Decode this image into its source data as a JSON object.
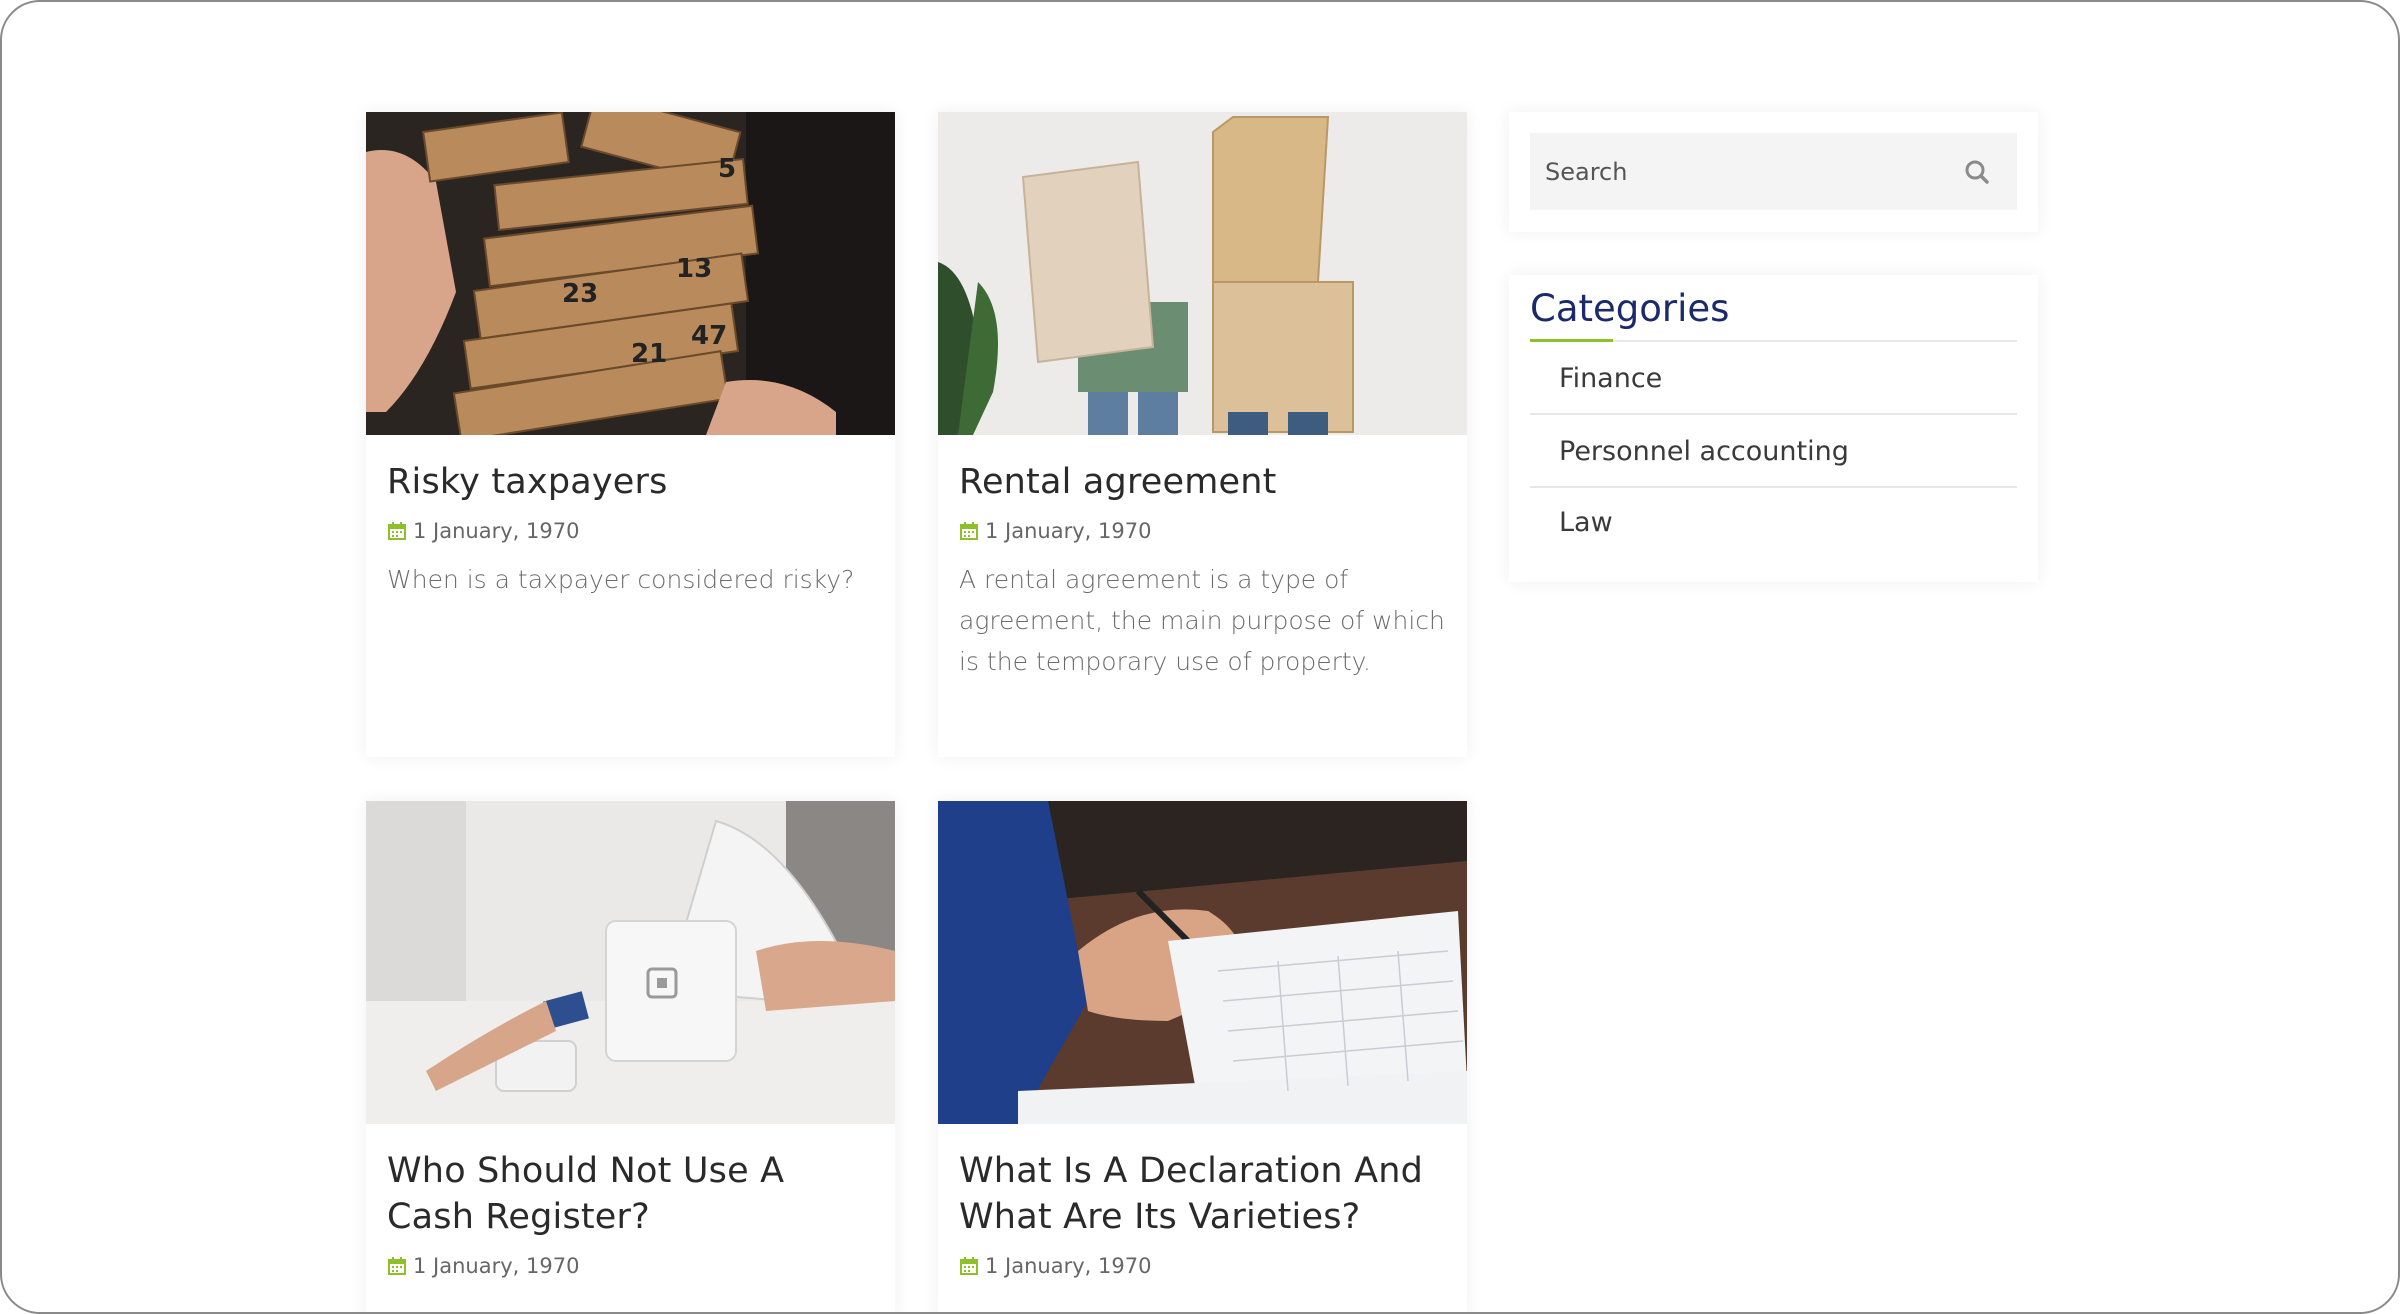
{
  "posts": [
    {
      "title": "Risky taxpayers",
      "date": "1 January, 1970",
      "excerpt": "When is a taxpayer considered risky?",
      "image_alt": "wooden block tower game"
    },
    {
      "title": "Rental agreement",
      "date": "1 January, 1970",
      "excerpt": "A rental agreement is a type of agreement, the main purpose of which is the temporary use of property.",
      "image_alt": "people carrying cardboard boxes"
    },
    {
      "title": "Who Should Not Use A Cash Register?",
      "date": "1 January, 1970",
      "excerpt": "",
      "image_alt": "card payment terminal"
    },
    {
      "title": "What Is A Declaration And What Are Its Varieties?",
      "date": "1 January, 1970",
      "excerpt": "",
      "image_alt": "hand signing a document"
    }
  ],
  "search": {
    "placeholder": "Search",
    "value": ""
  },
  "categories": {
    "title": "Categories",
    "items": [
      "Finance",
      "Personnel accounting",
      "Law"
    ]
  },
  "colors": {
    "accent_navy": "#1b2a6b",
    "accent_green": "#8fbf2a",
    "calendar_icon": "#8fbf2a"
  },
  "icons": {
    "date": "calendar-icon",
    "search": "search-icon"
  }
}
